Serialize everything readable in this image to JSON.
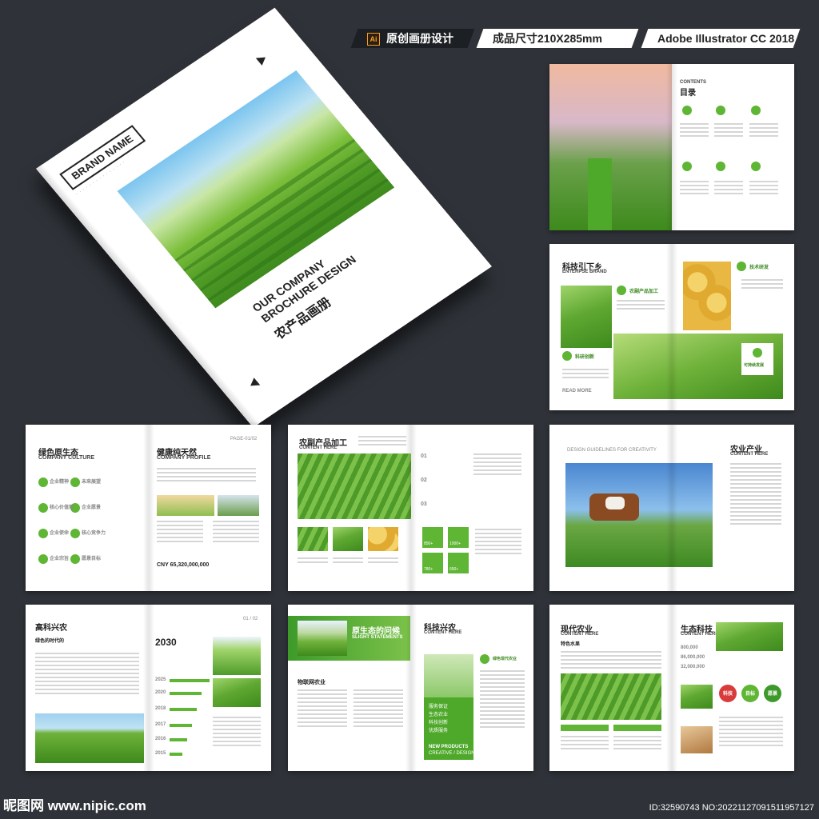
{
  "header": {
    "ai_label": "Ai",
    "design_label": "原创画册设计",
    "size_label": "成品尺寸210X285mm",
    "software_label": "Adobe Illustrator CC 2018"
  },
  "cover": {
    "brand": "BRAND NAME",
    "title_line1": "OUR COMPANY",
    "title_line2": "BROCHURE DESIGN",
    "title_cn": "农产品画册"
  },
  "spreads": {
    "contents": {
      "en": "CONTENTS",
      "cn": "目录",
      "item_label": "CONTENT HERE"
    },
    "tech": {
      "cn": "科技引下乡",
      "en": "ENTERPSE BRAND",
      "label1": "农副产品加工",
      "label2": "技术研发",
      "label3": "科研创新",
      "label4": "可持续发展",
      "read_more": "READ MORE"
    },
    "culture": {
      "left_cn": "绿色原生态",
      "left_en": "COMPANY CULTURE",
      "right_cn": "健康纯天然",
      "right_en": "COMPANY PROFILE",
      "page": "PAGE-01/02",
      "amount": "CNY 65,320,000,000",
      "items": [
        "企业精神",
        "未来展望",
        "核心价值观",
        "企业愿景",
        "企业使命",
        "核心竞争力",
        "企业宗旨",
        "愿景目标"
      ]
    },
    "processing": {
      "cn": "农副产品加工",
      "en": "CONTENT HERE",
      "numbered": [
        "01",
        "02",
        "03"
      ],
      "tiles": [
        "850+",
        "1000+",
        "780+",
        "650+"
      ]
    },
    "industry": {
      "caption": "DESIGN GUIDELINES FOR CREATIVITY",
      "cn": "农业产业",
      "en": "CONTENT HERE"
    },
    "timeline": {
      "cn": "高科兴农",
      "sub_cn": "绿色的时代的",
      "year_big": "2030",
      "years": [
        "2025",
        "2020",
        "2018",
        "2017",
        "2016",
        "2015"
      ],
      "page": "01 / 02"
    },
    "ecology": {
      "cn": "原生态的问候",
      "en": "SLIGHT STATEMENTS",
      "sub_cn": "物联网农业",
      "right_cn": "科技兴农",
      "right_en": "CONTENT HERE",
      "list": [
        "服务保证",
        "生态农业",
        "科技创新",
        "优质服务"
      ],
      "foot_left": "NEW PRODUCTS",
      "foot_sub": "CREATIVE / DESIGN",
      "label": "绿色现代农业"
    },
    "modern": {
      "cn": "现代农业",
      "en": "CONTENT HERE",
      "sub": "特色水果",
      "right_cn": "生态科技",
      "right_en": "CONTENT HERE",
      "figures": [
        "800,000",
        "86,000,000",
        "32,000,000"
      ],
      "badges": [
        "科技",
        "目标",
        "愿景"
      ]
    }
  },
  "footer": {
    "site": "昵图网 www.nipic.com",
    "id": "ID:32590743 NO:20221127091511957127"
  }
}
